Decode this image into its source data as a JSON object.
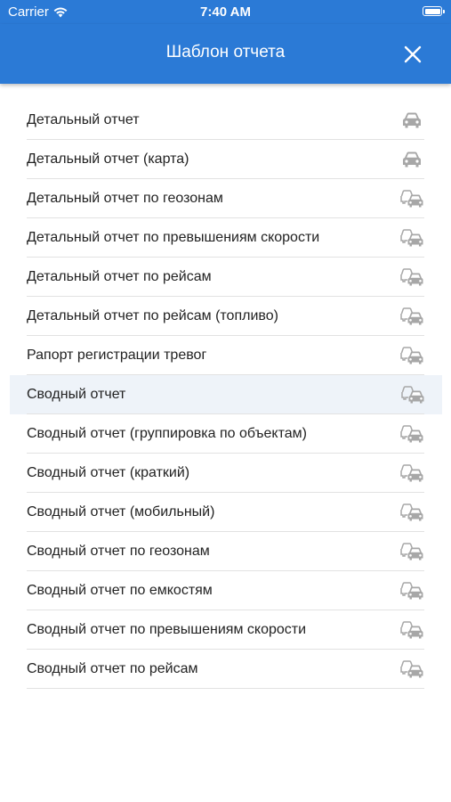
{
  "status_bar": {
    "carrier": "Carrier",
    "time": "7:40 AM"
  },
  "header": {
    "title": "Шаблон отчета",
    "close_icon": "close-icon"
  },
  "colors": {
    "header_bg": "#2b7ad6",
    "selected_row_bg": "#eef3f9",
    "icon_gray": "#a7a7a7"
  },
  "templates": [
    {
      "label": "Детальный отчет",
      "icon": "car-icon"
    },
    {
      "label": "Детальный отчет (карта)",
      "icon": "car-icon"
    },
    {
      "label": "Детальный отчет по геозонам",
      "icon": "group-cars-icon"
    },
    {
      "label": "Детальный отчет по превышениям скорости",
      "icon": "group-cars-icon"
    },
    {
      "label": "Детальный отчет по рейсам",
      "icon": "group-cars-icon"
    },
    {
      "label": "Детальный отчет по рейсам (топливо)",
      "icon": "group-cars-icon"
    },
    {
      "label": "Рапорт регистрации тревог",
      "icon": "group-cars-icon"
    },
    {
      "label": "Сводный отчет",
      "icon": "group-cars-icon",
      "selected": true
    },
    {
      "label": "Сводный отчет (группировка по объектам)",
      "icon": "group-cars-icon"
    },
    {
      "label": "Сводный отчет (краткий)",
      "icon": "group-cars-icon"
    },
    {
      "label": "Сводный отчет (мобильный)",
      "icon": "group-cars-icon"
    },
    {
      "label": "Сводный отчет по геозонам",
      "icon": "group-cars-icon"
    },
    {
      "label": "Сводный отчет по емкостям",
      "icon": "group-cars-icon"
    },
    {
      "label": "Сводный отчет по превышениям скорости",
      "icon": "group-cars-icon"
    },
    {
      "label": "Сводный отчет по рейсам",
      "icon": "group-cars-icon"
    }
  ]
}
